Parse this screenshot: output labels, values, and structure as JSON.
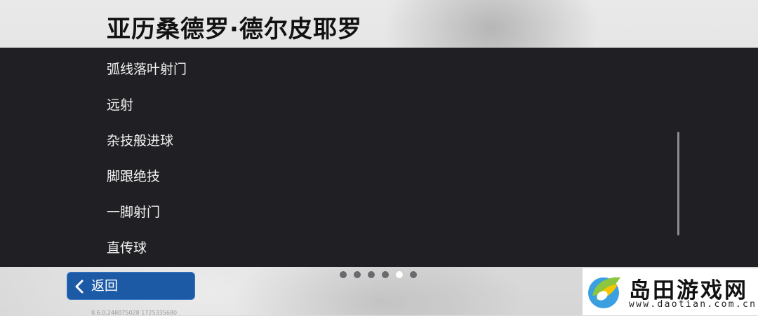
{
  "header": {
    "title": "亚历桑德罗·德尔皮耶罗"
  },
  "menu": {
    "items": [
      {
        "label": "弧线落叶射门"
      },
      {
        "label": "远射"
      },
      {
        "label": "杂技般进球"
      },
      {
        "label": "脚跟绝技"
      },
      {
        "label": "一脚射门"
      },
      {
        "label": "直传球"
      }
    ]
  },
  "pager": {
    "count": 6,
    "active_index": 4
  },
  "footer": {
    "back_label": "返回",
    "back_icon": "chevron-left-icon",
    "version": "8.6.0.248075028 1725335680"
  },
  "watermark": {
    "name": "岛田游戏网",
    "url": "www.daotian.com.cn"
  },
  "colors": {
    "panel": "#202024",
    "back_button": "#1d5aa6",
    "dot_active": "#ffffff",
    "dot_inactive": "#6a6a6e"
  }
}
